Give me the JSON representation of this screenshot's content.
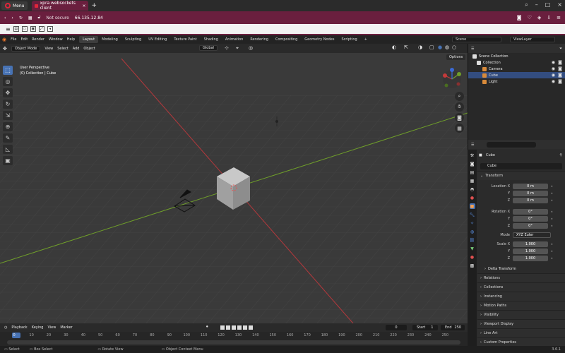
{
  "browser": {
    "menu_label": "Menu",
    "tab_title": "xpra websockets client",
    "security": "Not secure",
    "address": "66.135.12.84"
  },
  "blender": {
    "menus": [
      "File",
      "Edit",
      "Render",
      "Window",
      "Help"
    ],
    "workspaces": [
      "Layout",
      "Modeling",
      "Sculpting",
      "UV Editing",
      "Texture Paint",
      "Shading",
      "Animation",
      "Rendering",
      "Compositing",
      "Geometry Nodes",
      "Scripting"
    ],
    "active_workspace": "Layout",
    "scene": "Scene",
    "view_layer": "ViewLayer",
    "viewport": {
      "mode": "Object Mode",
      "menus": [
        "View",
        "Select",
        "Add",
        "Object"
      ],
      "transform_orientation": "Global",
      "options": "Options",
      "info_line1": "User Perspective",
      "info_line2": "(0) Collection | Cube"
    },
    "outliner": {
      "root": "Scene Collection",
      "collection": "Collection",
      "items": [
        "Camera",
        "Cube",
        "Light"
      ]
    },
    "properties": {
      "object_name": "Cube",
      "object_field": "Cube",
      "section_transform": "Transform",
      "location_x_label": "Location X",
      "location_x": "0 m",
      "y_label": "Y",
      "z_label": "Z",
      "location_y": "0 m",
      "location_z": "0 m",
      "rotation_x_label": "Rotation X",
      "rotation_x": "0°",
      "rotation_y": "0°",
      "rotation_z": "0°",
      "mode_label": "Mode",
      "mode_value": "XYZ Euler",
      "scale_x_label": "Scale X",
      "scale_x": "1.000",
      "scale_y": "1.000",
      "scale_z": "1.000",
      "delta_transform": "Delta Transform",
      "sections": [
        "Relations",
        "Collections",
        "Instancing",
        "Motion Paths",
        "Visibility",
        "Viewport Display",
        "Line Art",
        "Custom Properties"
      ]
    },
    "timeline": {
      "menus": [
        "Playback",
        "Keying",
        "View",
        "Marker"
      ],
      "current_frame": "0",
      "start_label": "Start",
      "start": "1",
      "end_label": "End",
      "end": "250",
      "frame_numbers": [
        "0",
        "10",
        "20",
        "30",
        "40",
        "50",
        "60",
        "70",
        "80",
        "90",
        "100",
        "110",
        "120",
        "130",
        "140",
        "150",
        "160",
        "170",
        "180",
        "190",
        "200",
        "210",
        "220",
        "230",
        "240",
        "250"
      ]
    },
    "statusbar": {
      "select": "Select",
      "box_select": "Box Select",
      "rotate_view": "Rotate View",
      "context_menu": "Object Context Menu",
      "version": "3.6.1"
    }
  },
  "colors": {
    "browser_accent": "#6a1f3e",
    "active_blue": "#4772b3",
    "x_axis": "#c43a3a",
    "y_axis": "#6f9e2a"
  }
}
